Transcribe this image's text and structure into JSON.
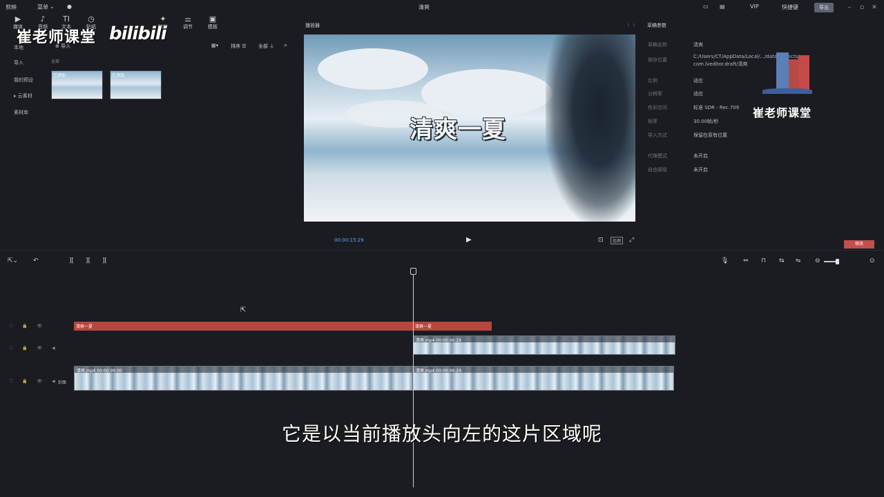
{
  "app": {
    "logo": "剪映",
    "menu": "菜单",
    "window_title": "清爽",
    "export_label": "导出",
    "vip_label": "VIP",
    "shortcut_label": "快捷键"
  },
  "toolbar": {
    "items": [
      {
        "label": "媒体",
        "icon": "media-icon"
      },
      {
        "label": "音频",
        "icon": "audio-icon"
      },
      {
        "label": "文本",
        "icon": "text-icon"
      },
      {
        "label": "贴纸",
        "icon": "sticker-icon"
      },
      {
        "label": "特效",
        "icon": "effects-icon"
      },
      {
        "label": "调节",
        "icon": "adjust-icon"
      },
      {
        "label": "模板",
        "icon": "template-icon"
      }
    ]
  },
  "watermark": {
    "left_text": "崔老师课堂",
    "bili_text": "bilibili",
    "right_text": "崔老师课堂"
  },
  "media": {
    "import_label": "导入",
    "sidebar": [
      "本地",
      "导入",
      "我的预设",
      "云素材",
      "素材库"
    ],
    "filter_label": "全部",
    "sort_label": "排序",
    "all_label": "全部",
    "thumbs": [
      {
        "label": "已添加"
      },
      {
        "label": "已添加"
      }
    ]
  },
  "player": {
    "title": "播放器",
    "video_text": "清爽一夏",
    "timecode": "00:00:15:29",
    "ratio_label": "比例"
  },
  "props": {
    "title": "草稿参数",
    "rows": [
      {
        "key": "草稿名称",
        "value": "清爽"
      },
      {
        "key": "保存位置",
        "value": "C:/Users/CT/AppData/Local/.../data/Projects/"
      },
      {
        "key": "",
        "value": "com.lveditor.draft/清爽"
      },
      {
        "key": "比例",
        "value": "适应"
      },
      {
        "key": "分辨率",
        "value": "适应"
      },
      {
        "key": "色彩空间",
        "value": "标准 SDR - Rec.709"
      },
      {
        "key": "帧率",
        "value": "30.00帧/秒"
      },
      {
        "key": "导入方式",
        "value": "保留在原有位置"
      },
      {
        "key": "代理模式",
        "value": "未开启"
      },
      {
        "key": "自由层级",
        "value": "未开启"
      }
    ],
    "modify_label": "修改"
  },
  "timeline": {
    "text_clips": [
      {
        "label": "清爽一夏"
      },
      {
        "label": "清爽一夏"
      }
    ],
    "upper_clip": {
      "label": "清爽.mp4  00:00:06:29"
    },
    "main_clips": [
      {
        "label": "清爽.mp4  00:00:09:00"
      },
      {
        "label": "清爽.mp4  00:00:06:29"
      }
    ],
    "cover_label": "封面"
  },
  "subtitle": "它是以当前播放头向左的这片区域呢"
}
